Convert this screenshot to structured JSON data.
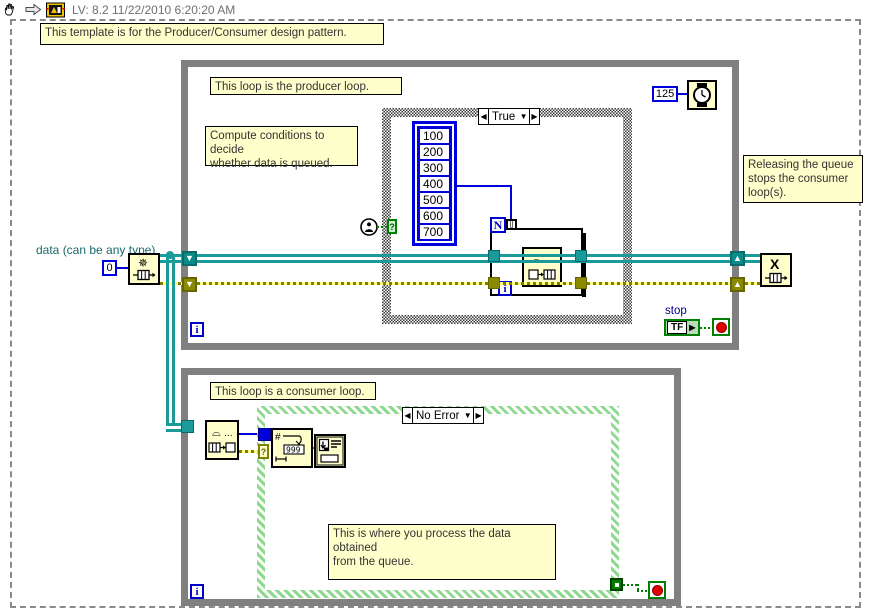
{
  "window": {
    "title": "LV: 8.2 11/22/2010 6:20:20 AM",
    "icons": [
      "hand-cursor-icon",
      "arrow-right-icon",
      "labview-vi-icon"
    ]
  },
  "comments": {
    "template": "This template is for the Producer/Consumer design pattern.",
    "producer_loop": "This loop is the producer loop.",
    "compute_conditions": "Compute conditions to decide\nwhether data is queued.",
    "release_queue": "Releasing the queue\nstops the consumer\nloop(s).",
    "consumer_loop": "This loop is a consumer loop.",
    "process_data": "This is where you process the data obtained\nfrom the queue."
  },
  "labels": {
    "data_input": "data (can be any type)",
    "stop": "stop"
  },
  "constants": {
    "queue_size": "0",
    "wait_ms": "125",
    "dialog_format": "999"
  },
  "array_constant": {
    "values": [
      "100",
      "200",
      "300",
      "400",
      "500",
      "600",
      "700"
    ]
  },
  "case_structures": {
    "producer_case": {
      "selector": "True",
      "left_arrow": "◀",
      "right_arrow": "▶",
      "chevron": "▼"
    },
    "consumer_case": {
      "selector": "No Error",
      "left_arrow": "◀",
      "right_arrow": "▶",
      "chevron": "▼"
    }
  },
  "nodes": {
    "obtain_queue": "obtain-queue-vi",
    "enqueue_element": "enqueue-element-vi",
    "release_queue": "release-queue-vi",
    "dequeue_element": "dequeue-element-vi",
    "wait_ms": "wait-ms-vi",
    "number_to_string": "number-to-decimal-string-vi",
    "one_button_dialog": "one-button-dialog-vi",
    "true_constant": "true-constant"
  },
  "loop_iterators": {
    "producer": "i",
    "consumer": "i",
    "for_loop_count": "N",
    "for_loop_index": "i"
  },
  "boolean": {
    "stop_terminal_label": "TF"
  },
  "colors": {
    "comment_bg": "#ffffcc",
    "loop_border": "#808080",
    "numeric_blue": "#0000dc",
    "queue_teal": "#1b9a9a",
    "error_olive": "#808000",
    "boolean_green": "#008000",
    "string_pink": "#ff00ff",
    "vi_bg": "#ffffcc"
  }
}
